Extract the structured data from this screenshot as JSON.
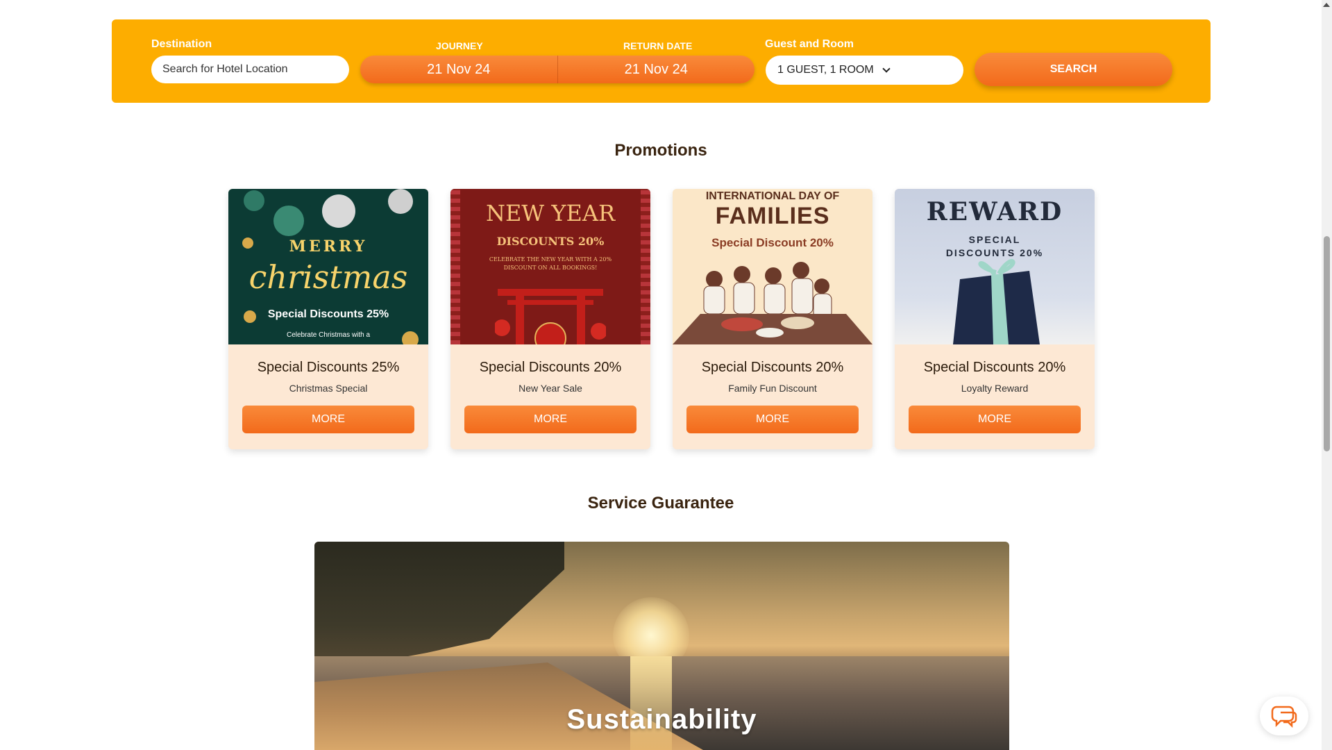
{
  "search": {
    "destination_label": "Destination",
    "destination_placeholder": "Search for Hotel Location",
    "journey_label": "JOURNEY",
    "journey_value": "21 Nov 24",
    "return_label": "RETURN DATE",
    "return_value": "21 Nov 24",
    "guest_label": "Guest and Room",
    "guest_value": "1 GUEST, 1 ROOM",
    "search_label": "SEARCH"
  },
  "promotions": {
    "title": "Promotions",
    "cards": [
      {
        "title": "Special Discounts 25%",
        "subtitle": "Christmas Special",
        "button": "MORE",
        "image_text": {
          "line1": "MERRY",
          "line2": "christmas",
          "line3": "Special Discounts 25%",
          "line4": "Celebrate Christmas with a"
        }
      },
      {
        "title": "Special Discounts 20%",
        "subtitle": "New Year Sale",
        "button": "MORE",
        "image_text": {
          "line1": "NEW YEAR",
          "line2": "DISCOUNTS 20%",
          "line3": "CELEBRATE THE NEW YEAR WITH A 20% DISCOUNT ON ALL BOOKINGS!"
        }
      },
      {
        "title": "Special Discounts 20%",
        "subtitle": "Family Fun Discount",
        "button": "MORE",
        "image_text": {
          "line1": "INTERNATIONAL DAY OF",
          "line2": "FAMILIES",
          "line3": "Special Discount 20%"
        }
      },
      {
        "title": "Special Discounts 20%",
        "subtitle": "Loyalty Reward",
        "button": "MORE",
        "image_text": {
          "line1": "REWARD",
          "line2": "SPECIAL",
          "line3": "DISCOUNTS 20%"
        }
      }
    ]
  },
  "service": {
    "title": "Service Guarantee",
    "banner_text": "Sustainability"
  },
  "colors": {
    "accent": "#fdad00",
    "button": "#f26a1b",
    "card_bg": "#fde8d4"
  },
  "icons": [
    "chevron-down-icon",
    "chat-icon"
  ]
}
